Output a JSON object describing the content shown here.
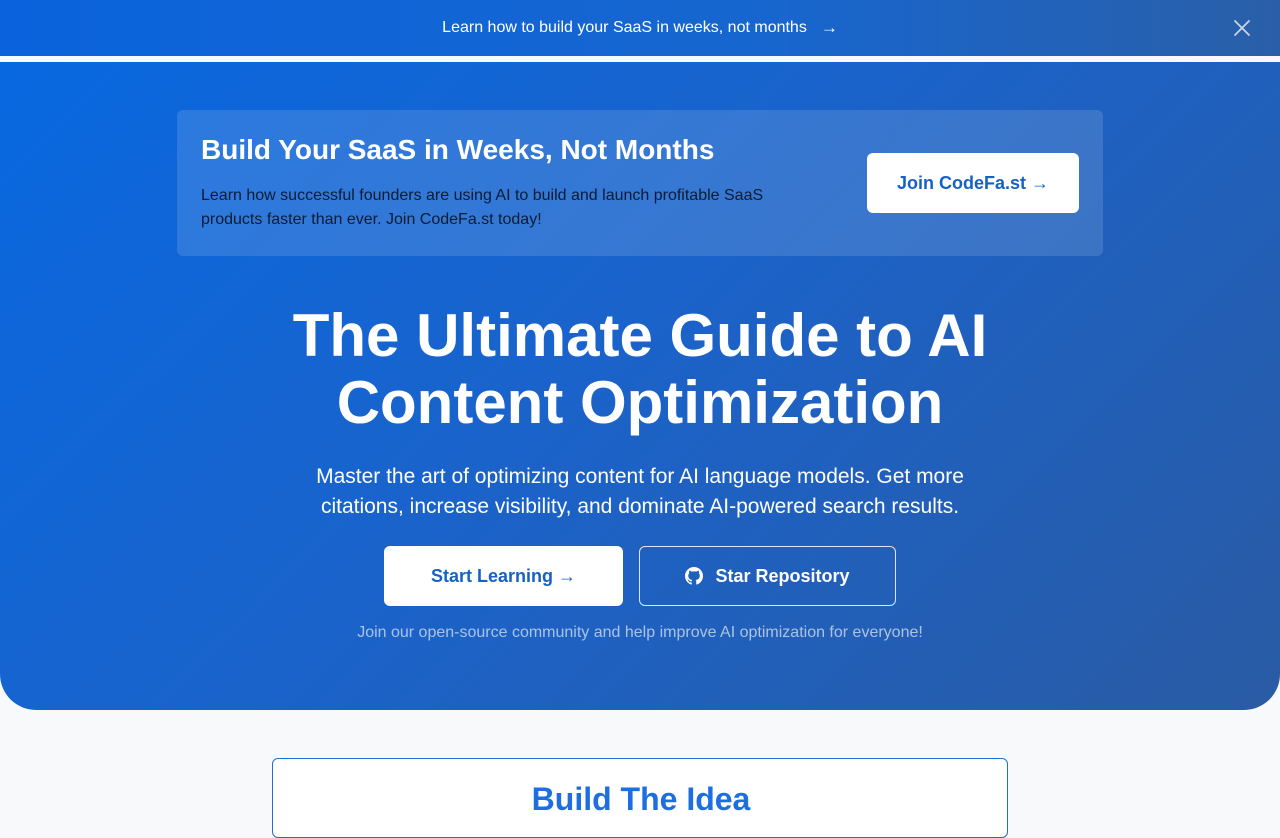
{
  "announcement": {
    "text": "Learn how to build your SaaS in weeks, not months",
    "arrow": "→",
    "close_icon": "close-icon"
  },
  "promo": {
    "title": "Build Your SaaS in Weeks, Not Months",
    "description": "Learn how successful founders are using AI to build and launch profitable SaaS products faster than ever. Join CodeFa.st today!",
    "button_label": "Join CodeFa.st →"
  },
  "hero": {
    "title": "The Ultimate Guide to AI Content Optimization",
    "subtitle": "Master the art of optimizing content for AI language models. Get more citations, increase visibility, and dominate AI-powered search results.",
    "primary_button": "Start Learning →",
    "secondary_button": "Star Repository",
    "secondary_icon": "github-icon",
    "community_note": "Join our open-source community and help improve AI optimization for everyone!"
  },
  "next_section": {
    "title": "Build The Idea"
  },
  "colors": {
    "brand_blue": "#1662c4",
    "hero_start": "#0868e0",
    "hero_end": "#2a5ba4",
    "background": "#f8f9fb"
  }
}
